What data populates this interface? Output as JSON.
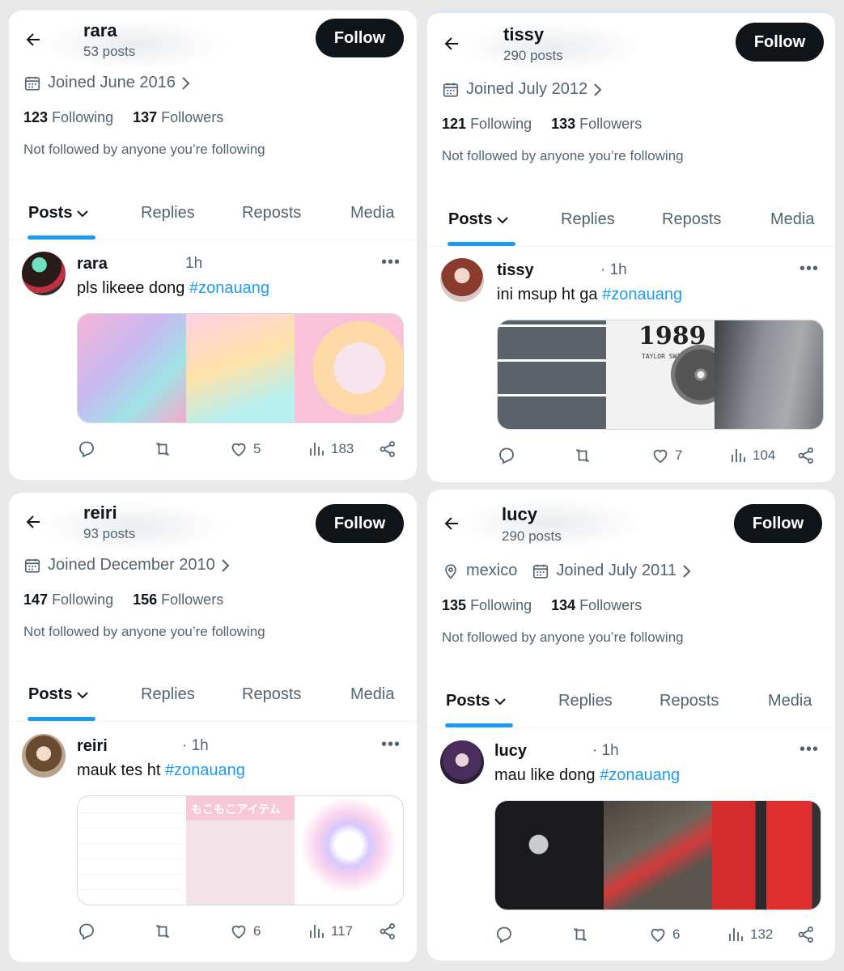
{
  "common": {
    "follow_label": "Follow",
    "not_followed_text": "Not followed by anyone you’re following",
    "following_word": "Following",
    "followers_word": "Followers",
    "tabs": [
      "Posts",
      "Replies",
      "Reposts",
      "Media"
    ],
    "colors": {
      "accent": "#1d9bf0",
      "text": "#0f1419",
      "muted": "#536471",
      "button": "#0f1419"
    }
  },
  "profiles": [
    {
      "name": "rara",
      "posts_count": "53 posts",
      "joined": "Joined June 2016",
      "following_count": "123",
      "followers_count": "137",
      "post": {
        "author": "rara",
        "time": "1h",
        "text": "pls likeee dong ",
        "hashtag": "#zonauang",
        "likes": "5",
        "views": "183",
        "media_alt": "sanrio toy collage"
      }
    },
    {
      "name": "tissy",
      "posts_count": "290 posts",
      "joined": "Joined July 2012",
      "following_count": "121",
      "followers_count": "133",
      "post": {
        "author": "tissy",
        "time": "· 1h",
        "text": "ini msup ht ga ",
        "hashtag": "#zonauang",
        "likes": "7",
        "views": "104",
        "media_alt": "1989 album collage"
      }
    },
    {
      "name": "reiri",
      "posts_count": "93 posts",
      "joined": "Joined December 2010",
      "following_count": "147",
      "followers_count": "156",
      "post": {
        "author": "reiri",
        "time": "· 1h",
        "text": "mauk tes ht ",
        "hashtag": "#zonauang",
        "likes": "6",
        "views": "117",
        "media_alt": "love language collage"
      }
    },
    {
      "name": "lucy",
      "posts_count": "290 posts",
      "location": "mexico",
      "joined": "Joined July 2011",
      "following_count": "135",
      "followers_count": "134",
      "post": {
        "author": "lucy",
        "time": "· 1h",
        "text": "mau like dong ",
        "hashtag": "#zonauang",
        "likes": "6",
        "views": "132",
        "media_alt": "phone and cans collage"
      }
    }
  ],
  "album_text": {
    "title": "1989",
    "artist": "TAYLOR SWIFT",
    "mokomoko": "もこもこアイテム"
  }
}
